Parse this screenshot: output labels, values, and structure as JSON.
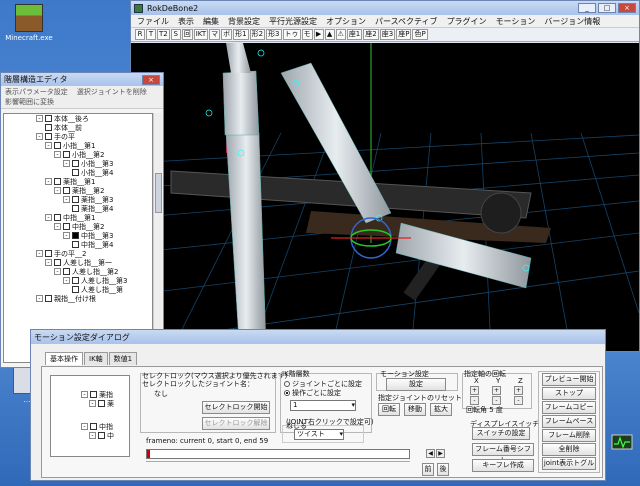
{
  "desktop": {
    "icons": [
      {
        "label": "Minecraft.exe"
      },
      {
        "label": "…"
      }
    ]
  },
  "main_window": {
    "title": "RokDeBone2",
    "menu": [
      "ファイル",
      "表示",
      "編集",
      "背景設定",
      "平行光源設定",
      "オプション",
      "パースペクティブ",
      "プラグイン",
      "モーション",
      "バージョン情報"
    ],
    "toolbar": [
      "R",
      "T",
      "T2",
      "S",
      "回",
      "IKT",
      "マ",
      "ボ",
      "形1",
      "形2",
      "形3",
      "トゥ",
      "モ",
      "▶",
      "▲",
      "⚠",
      "座1",
      "座2",
      "座3",
      "座P",
      "色P"
    ]
  },
  "joint_window": {
    "title": "階層構造エディタ",
    "menu": [
      "表示パラメータ設定",
      "選択ジョイントを削除",
      "影響範囲に変換"
    ],
    "tree": [
      {
        "label": "本体__後ろ",
        "depth": 0,
        "exp": "-",
        "checked": false
      },
      {
        "label": "本体__前",
        "depth": 1,
        "exp": "",
        "checked": false
      },
      {
        "label": "手の平",
        "depth": 0,
        "exp": "-",
        "checked": false
      },
      {
        "label": "小指__第1",
        "depth": 1,
        "exp": "-",
        "checked": false
      },
      {
        "label": "小指__第2",
        "depth": 2,
        "exp": "-",
        "checked": false
      },
      {
        "label": "小指__第3",
        "depth": 3,
        "exp": "-",
        "checked": false
      },
      {
        "label": "小指__第4",
        "depth": 4,
        "exp": "",
        "checked": false
      },
      {
        "label": "薬指__第1",
        "depth": 1,
        "exp": "-",
        "checked": false
      },
      {
        "label": "薬指__第2",
        "depth": 2,
        "exp": "-",
        "checked": false
      },
      {
        "label": "薬指__第3",
        "depth": 3,
        "exp": "-",
        "checked": false
      },
      {
        "label": "薬指__第4",
        "depth": 4,
        "exp": "",
        "checked": false
      },
      {
        "label": "中指__第1",
        "depth": 1,
        "exp": "-",
        "checked": false
      },
      {
        "label": "中指__第2",
        "depth": 2,
        "exp": "-",
        "checked": false
      },
      {
        "label": "中指__第3",
        "depth": 3,
        "exp": "-",
        "checked": true
      },
      {
        "label": "中指__第4",
        "depth": 4,
        "exp": "",
        "checked": false
      },
      {
        "label": "手の平__2",
        "depth": 0,
        "exp": "-",
        "checked": false
      },
      {
        "label": "人差し指__第一",
        "depth": 1,
        "exp": "-",
        "checked": false
      },
      {
        "label": "人差し指__第2",
        "depth": 2,
        "exp": "-",
        "checked": false
      },
      {
        "label": "人差し指__第3",
        "depth": 3,
        "exp": "-",
        "checked": false
      },
      {
        "label": "人差し指__第",
        "depth": 4,
        "exp": "",
        "checked": false
      },
      {
        "label": "親指__付け根",
        "depth": 0,
        "exp": "-",
        "checked": false
      }
    ]
  },
  "motion_window": {
    "title": "モーション設定ダイアログ",
    "tabs": [
      "基本操作",
      "IK軸",
      "数値1"
    ],
    "mini_tree": [
      "薬指",
      "薬",
      "中指",
      "中"
    ],
    "selectlock_text1": "セレクトロック(マウス選択より優先されます)",
    "selectlock_text2": "セレクトロックしたジョイント名：",
    "selectlock_value": "なし",
    "selectlock_start": "セレクトロック開始",
    "selectlock_release": "セレクトロック解除",
    "ik_label": "IK階層数",
    "ik_opt1": "ジョイントごとに設定",
    "ik_opt2": "操作ごとに設定",
    "ik_value": "1",
    "ik_hint": "(JOINT右クリックで設定可)",
    "frame_info": "frameno: current 0, start 0, end 59",
    "neji_label": "ねじる",
    "neji_value": "ツイスト",
    "motion_group": "モーション設定",
    "motion_set": "設定",
    "reset_group": "指定ジョイントのリセット",
    "reset_btns": [
      "回転",
      "移動",
      "拡大"
    ],
    "axis_group": "指定軸の回転",
    "axis_labels": [
      "X",
      "Y",
      "Z"
    ],
    "axis_angle": "回転角 5 度",
    "display_switch": "ディスプレイスイッチ",
    "switch_set": "スイッチの設定",
    "frame_shift": "フレーム番号シフト",
    "keyframe": "キーフレ作成",
    "right_btns": [
      "プレビュー開始",
      "ストップ",
      "フレームコピー",
      "フレームペースト",
      "フレーム削除",
      "全削除",
      "joint表示トグル"
    ],
    "prev": "前",
    "next": "後"
  }
}
